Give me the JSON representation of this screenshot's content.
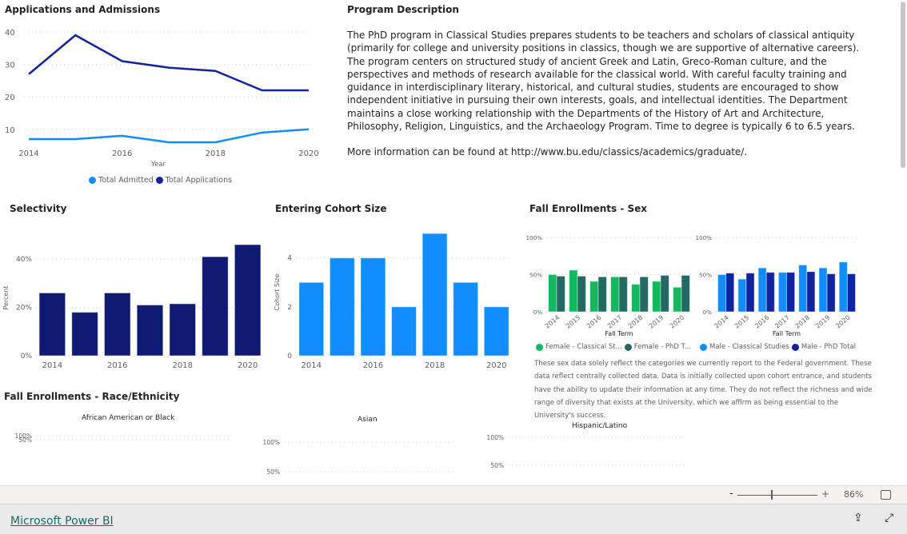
{
  "applications": {
    "title": "Applications and Admissions",
    "legend": [
      {
        "label": "Total Admitted",
        "color": "#118dff"
      },
      {
        "label": "Total Applications",
        "color": "#12239e"
      }
    ]
  },
  "program": {
    "title": "Program Description",
    "paragraph1": "The PhD program in Classical Studies prepares students to be teachers and scholars of classical antiquity (primarily for college and university positions in classics, though we are supportive of alternative careers). The program centers on structured study of ancient Greek and Latin, Greco-Roman culture, and the perspectives and methods of research available for the classical world. With careful faculty training and guidance in interdisciplinary literary, historical, and cultural studies, students are encouraged to show independent initiative in pursuing their own interests, goals, and intellectual identities. The Department maintains a close working relationship with the Departments of the History of Art and Architecture, Philosophy, Religion, Linguistics, and the Archaeology Program. Time to degree is typically 6 to 6.5 years.",
    "paragraph2": "More information can be found at http://www.bu.edu/classics/academics/graduate/."
  },
  "selectivity": {
    "title": "Selectivity"
  },
  "cohort": {
    "title": "Entering Cohort Size"
  },
  "sex": {
    "title": "Fall Enrollments - Sex",
    "female_legend": [
      {
        "label": "Female - Classical St...",
        "color": "#12b95f"
      },
      {
        "label": "Female - PhD T...",
        "color": "#236a62"
      }
    ],
    "male_legend": [
      {
        "label": "Male - Classical Studies",
        "color": "#118dff"
      },
      {
        "label": "Male - PhD Total",
        "color": "#12239e"
      }
    ],
    "note": "These sex data solely reflect the categories we currently report to the Federal government. These data reflect centrally collected data. Data is initially collected upon cohort entrance, and students have the ability to update their information at any time. They do not reflect the richness and wide range of diversity that exists at the University, which we affirm as being essential to the University's success."
  },
  "race": {
    "title": "Fall  Enrollments - Race/Ethnicity",
    "charts": [
      {
        "subtitle": "African American or Black"
      },
      {
        "subtitle": "Asian"
      },
      {
        "subtitle": "Hispanic/Latino"
      }
    ]
  },
  "zoom": {
    "minus": "-",
    "plus": "+",
    "level": "86%",
    "value_percent": 86
  },
  "footer": {
    "brand": "Microsoft Power BI"
  },
  "chart_data": [
    {
      "id": "applications",
      "type": "line",
      "x": [
        2014,
        2015,
        2016,
        2017,
        2018,
        2019,
        2020
      ],
      "xticks": [
        "2014",
        "2016",
        "2018",
        "2020"
      ],
      "xlabel": "Year",
      "ylabel": "",
      "yticks": [
        "10",
        "20",
        "30",
        "40"
      ],
      "ylim": [
        6,
        40
      ],
      "grid": true,
      "legend": "bottom",
      "series": [
        {
          "name": "Total Admitted",
          "color": "#118dff",
          "values": [
            7,
            7,
            8,
            6,
            6,
            9,
            10
          ]
        },
        {
          "name": "Total Applications",
          "color": "#12239e",
          "values": [
            27,
            39,
            31,
            29,
            28,
            22,
            22
          ]
        }
      ]
    },
    {
      "id": "selectivity",
      "type": "bar",
      "categories": [
        "2014",
        "2015",
        "2016",
        "2017",
        "2018",
        "2019",
        "2020"
      ],
      "xticks": [
        "2014",
        "2016",
        "2018",
        "2020"
      ],
      "ylabel": "Percent",
      "yticks": [
        "0%",
        "20%",
        "40%"
      ],
      "ylim": [
        0,
        48
      ],
      "color": "#0f1a73",
      "values": [
        26,
        18,
        26,
        21,
        21.5,
        41,
        46
      ]
    },
    {
      "id": "cohort",
      "type": "bar",
      "categories": [
        "2014",
        "2015",
        "2016",
        "2017",
        "2018",
        "2019",
        "2020"
      ],
      "xticks": [
        "2014",
        "2016",
        "2018",
        "2020"
      ],
      "ylabel": "Cohort Size",
      "yticks": [
        "0",
        "2",
        "4"
      ],
      "ylim": [
        0,
        5.2
      ],
      "color": "#118dff",
      "values": [
        3,
        4,
        4,
        2,
        5,
        3,
        2
      ]
    },
    {
      "id": "female",
      "type": "bar",
      "categories": [
        "2014",
        "2015",
        "2016",
        "2017",
        "2018",
        "2019",
        "2020"
      ],
      "xlabel": "Fall Term",
      "yticks": [
        "0%",
        "50%",
        "100%"
      ],
      "ylim": [
        0,
        100
      ],
      "series": [
        {
          "name": "Female - Classical Studies",
          "color": "#12b95f",
          "values": [
            50,
            56,
            41,
            47,
            37,
            41,
            33
          ]
        },
        {
          "name": "Female - PhD Total",
          "color": "#236a62",
          "values": [
            48,
            48,
            47,
            47,
            47,
            49,
            49
          ]
        }
      ]
    },
    {
      "id": "male",
      "type": "bar",
      "categories": [
        "2014",
        "2015",
        "2016",
        "2017",
        "2018",
        "2019",
        "2020"
      ],
      "xlabel": "Fall Term",
      "yticks": [
        "0%",
        "50%",
        "100%"
      ],
      "ylim": [
        0,
        100
      ],
      "series": [
        {
          "name": "Male - Classical Studies",
          "color": "#118dff",
          "values": [
            50,
            44,
            59,
            53,
            63,
            59,
            67
          ]
        },
        {
          "name": "Male - PhD Total",
          "color": "#12239e",
          "values": [
            52,
            52,
            53,
            53,
            54,
            51,
            51
          ]
        }
      ]
    },
    {
      "id": "race-black",
      "type": "bar",
      "yticks": [
        "50%",
        "100%"
      ]
    },
    {
      "id": "race-asian",
      "type": "bar",
      "yticks": [
        "50%",
        "100%"
      ]
    },
    {
      "id": "race-hispanic",
      "type": "bar",
      "yticks": [
        "50%",
        "100%"
      ]
    }
  ]
}
